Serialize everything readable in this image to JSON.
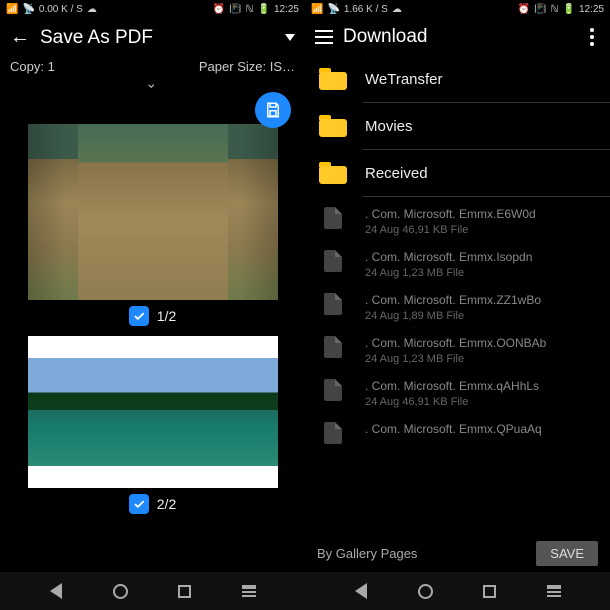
{
  "left": {
    "status": {
      "net": "0.00 K / S",
      "time": "12:25"
    },
    "title": "Save As PDF",
    "copy_label": "Copy: 1",
    "paper_label": "Paper Size: IS…",
    "pages": [
      {
        "indicator": "1/2"
      },
      {
        "indicator": "2/2"
      }
    ]
  },
  "right": {
    "status": {
      "net": "1.66 K / S",
      "time": "12:25"
    },
    "title": "Download",
    "folders": [
      {
        "label": "WeTransfer"
      },
      {
        "label": "Movies"
      },
      {
        "label": "Received"
      }
    ],
    "files": [
      {
        "name": ". Com. Microsoft. Emmx.E6W0d",
        "meta": "24 Aug 46,91 KB File"
      },
      {
        "name": ". Com. Microsoft. Emmx.Isopdn",
        "meta": "24 Aug 1,23 MB File"
      },
      {
        "name": ". Com. Microsoft. Emmx.ZZ1wBo",
        "meta": "24 Aug 1,89 MB File"
      },
      {
        "name": ". Com. Microsoft. Emmx.OONBAb",
        "meta": "24 Aug 1,23 MB File"
      },
      {
        "name": ". Com. Microsoft. Emmx.qAHhLs",
        "meta": "24 Aug 46,91 KB File"
      },
      {
        "name": ". Com. Microsoft. Emmx.QPuaAq",
        "meta": ""
      }
    ],
    "footer_label": "By Gallery Pages",
    "save_label": "SAVE"
  }
}
